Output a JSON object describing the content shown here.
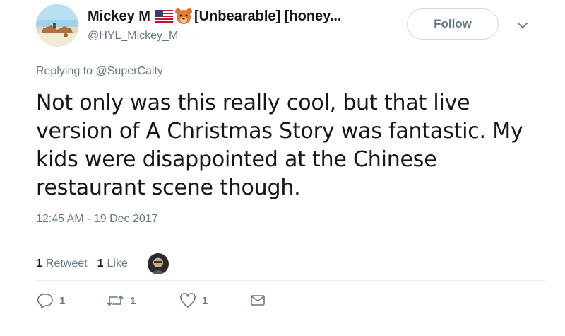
{
  "tweet": {
    "display_name": "Mickey M",
    "display_name_rest": "[Unbearable] [honey...",
    "handle": "@HYL_Mickey_M",
    "follow_label": "Follow",
    "replying_prefix": "Replying to",
    "replying_handle": "@SuperCaity",
    "text_lines": [
      "Not only was this really cool, but that live",
      "version of A Christmas Story was fantastic. My",
      "kids were disappointed at the Chinese",
      "restaurant scene though."
    ],
    "timestamp": "12:45 AM - 19 Dec 2017",
    "stats": {
      "retweets_count": "1",
      "retweets_label": "Retweet",
      "likes_count": "1",
      "likes_label": "Like"
    },
    "actions": {
      "reply_count": "1",
      "retweet_count": "1",
      "like_count": "1"
    }
  },
  "icons": {
    "flag": "us-flag-icon",
    "bear": "bear-face-icon",
    "more": "chevron-down-icon",
    "reply": "reply-icon",
    "retweet": "retweet-icon",
    "like": "heart-icon",
    "dm": "envelope-icon"
  },
  "colors": {
    "text": "#14171a",
    "secondary": "#657786",
    "border": "#cfd9de"
  }
}
